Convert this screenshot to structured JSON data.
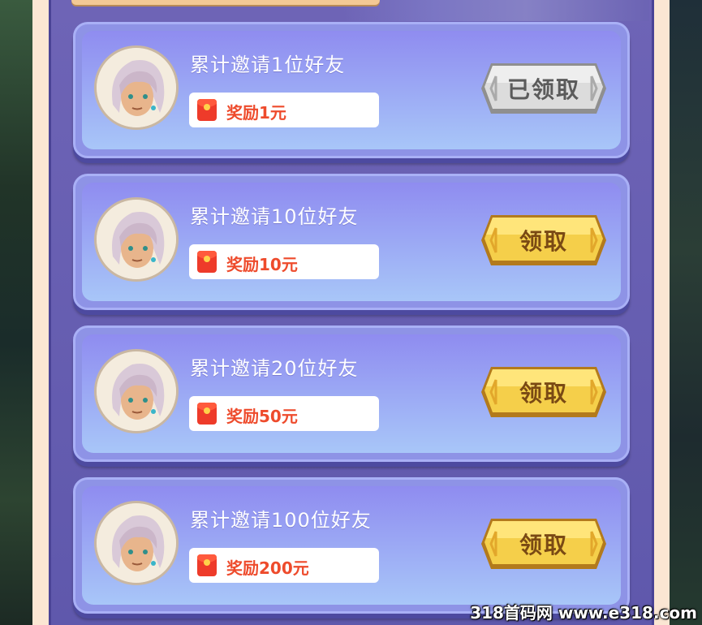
{
  "rewards": {
    "items": [
      {
        "title": "累计邀请1位好友",
        "reward_prefix": "奖励",
        "reward_amount": "1",
        "reward_unit": "元",
        "button_label": "已领取",
        "status": "claimed"
      },
      {
        "title": "累计邀请10位好友",
        "reward_prefix": "奖励",
        "reward_amount": "10",
        "reward_unit": "元",
        "button_label": "领取",
        "status": "available"
      },
      {
        "title": "累计邀请20位好友",
        "reward_prefix": "奖励",
        "reward_amount": "50",
        "reward_unit": "元",
        "button_label": "领取",
        "status": "available"
      },
      {
        "title": "累计邀请100位好友",
        "reward_prefix": "奖励",
        "reward_amount": "200",
        "reward_unit": "元",
        "button_label": "领取",
        "status": "available"
      }
    ]
  },
  "icons": {
    "avatar": "character-avatar-icon",
    "reward": "red-envelope-icon"
  },
  "colors": {
    "card": "#9aa6f4",
    "panel": "#6e64b6",
    "frame": "#fbe6d3",
    "claim_button": "#f5cf4a",
    "claimed_button": "#cfcfcf",
    "reward_text": "#ee4b2c"
  },
  "watermark": "318首码网 www.e318.com"
}
